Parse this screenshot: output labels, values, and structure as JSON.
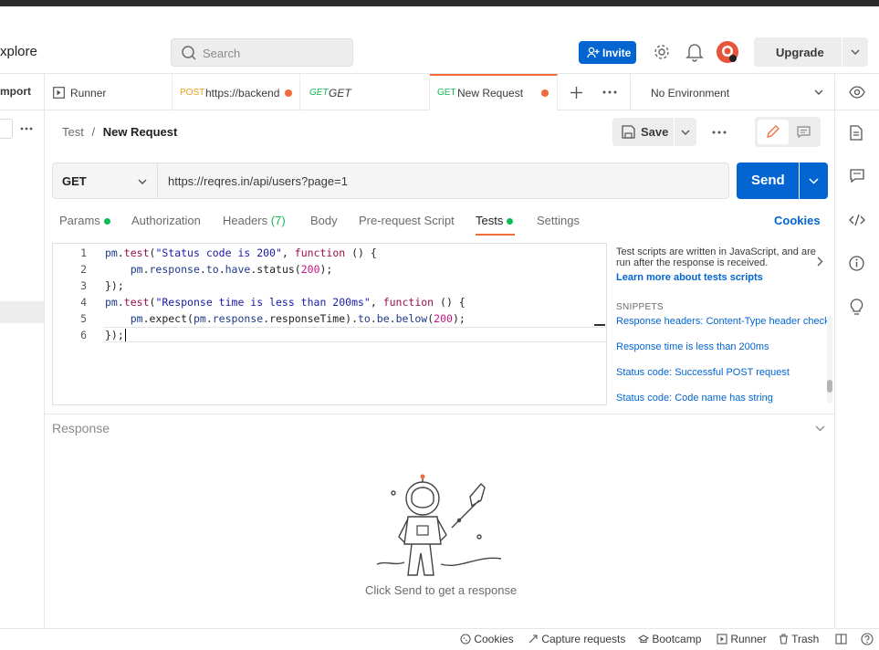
{
  "header": {
    "explore_label": "xplore",
    "search_placeholder": "Search",
    "invite_label": "Invite",
    "upgrade_label": "Upgrade"
  },
  "sidebar": {
    "import_label": "mport"
  },
  "tabs": [
    {
      "method": "",
      "label": "Runner"
    },
    {
      "method": "POST",
      "label": "https://backend"
    },
    {
      "method": "GET",
      "label": "GET"
    },
    {
      "method": "GET",
      "label": "New Request"
    }
  ],
  "environment": {
    "label": "No Environment"
  },
  "breadcrumb": {
    "collection": "Test",
    "separator": "/",
    "request": "New Request"
  },
  "toolbar": {
    "save_label": "Save"
  },
  "request": {
    "method": "GET",
    "url": "https://reqres.in/api/users?page=1",
    "send_label": "Send"
  },
  "subtabs": {
    "params": "Params",
    "authorization": "Authorization",
    "headers": "Headers",
    "headers_count": "(7)",
    "body": "Body",
    "prerequest": "Pre-request Script",
    "tests": "Tests",
    "settings": "Settings",
    "cookies": "Cookies"
  },
  "editor": {
    "line_numbers": [
      "1",
      "2",
      "3",
      "4",
      "5",
      "6"
    ]
  },
  "help": {
    "text": "Test scripts are written in JavaScript, and are run after the response is received.",
    "learn_more": "Learn more about tests scripts",
    "snippets_heading": "SNIPPETS",
    "snippets": [
      "Response headers: Content-Type header check",
      "Response time is less than 200ms",
      "Status code: Successful POST request",
      "Status code: Code name has string"
    ]
  },
  "response": {
    "label": "Response",
    "hint": "Click Send to get a response"
  },
  "footer": {
    "cookies": "Cookies",
    "capture": "Capture requests",
    "bootcamp": "Bootcamp",
    "runner": "Runner",
    "trash": "Trash"
  },
  "colors": {
    "accent": "#f26b3a",
    "primary": "#0265d2",
    "get": "#0cbb52",
    "post": "#ea9b18"
  }
}
